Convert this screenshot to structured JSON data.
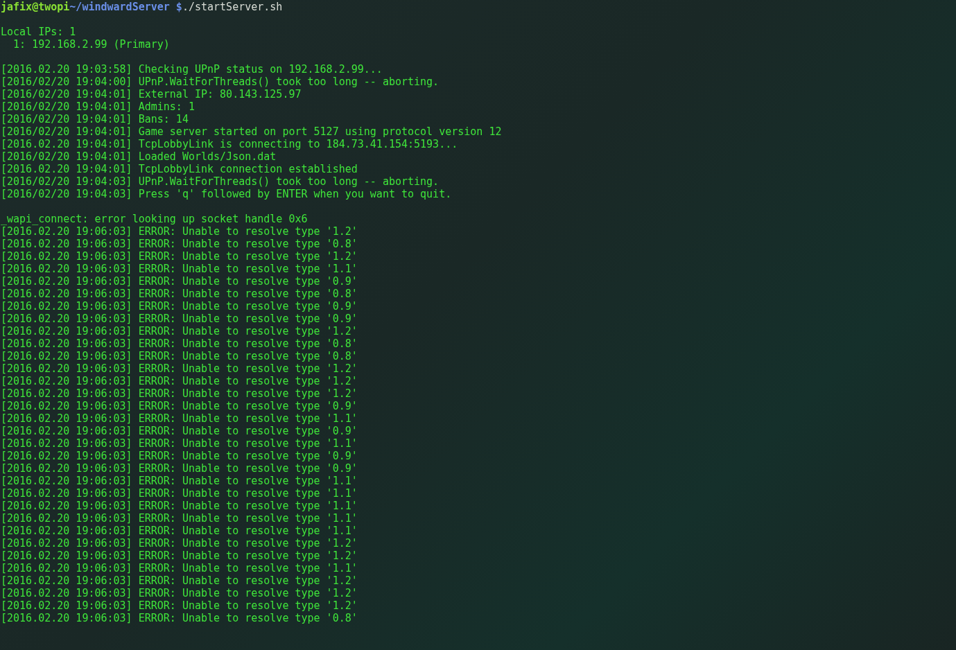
{
  "terminal": {
    "lines": [
      {
        "kind": "prompt",
        "user": "jafix@twopi",
        "path": "~/windwardServer $",
        "command": "./startServer.sh"
      },
      {
        "kind": "blank"
      },
      {
        "kind": "text",
        "text": "Local IPs: 1"
      },
      {
        "kind": "text",
        "text": "  1: 192.168.2.99 (Primary)"
      },
      {
        "kind": "blank"
      },
      {
        "kind": "text",
        "text": "[2016.02.20 19:03:58] Checking UPnP status on 192.168.2.99..."
      },
      {
        "kind": "text",
        "text": "[2016/02/20 19:04:00] UPnP.WaitForThreads() took too long -- aborting."
      },
      {
        "kind": "text",
        "text": "[2016/02/20 19:04:01] External IP: 80.143.125.97"
      },
      {
        "kind": "text",
        "text": "[2016/02/20 19:04:01] Admins: 1"
      },
      {
        "kind": "text",
        "text": "[2016/02/20 19:04:01] Bans: 14"
      },
      {
        "kind": "text",
        "text": "[2016/02/20 19:04:01] Game server started on port 5127 using protocol version 12"
      },
      {
        "kind": "text",
        "text": "[2016.02.20 19:04:01] TcpLobbyLink is connecting to 184.73.41.154:5193..."
      },
      {
        "kind": "text",
        "text": "[2016/02/20 19:04:01] Loaded Worlds/Json.dat"
      },
      {
        "kind": "text",
        "text": "[2016.02.20 19:04:01] TcpLobbyLink connection established"
      },
      {
        "kind": "text",
        "text": "[2016/02/20 19:04:03] UPnP.WaitForThreads() took too long -- aborting."
      },
      {
        "kind": "text",
        "text": "[2016/02/20 19:04:03] Press 'q' followed by ENTER when you want to quit."
      },
      {
        "kind": "blank"
      },
      {
        "kind": "text",
        "text": "_wapi_connect: error looking up socket handle 0x6"
      },
      {
        "kind": "text",
        "text": "[2016.02.20 19:06:03] ERROR: Unable to resolve type '1.2'"
      },
      {
        "kind": "text",
        "text": "[2016.02.20 19:06:03] ERROR: Unable to resolve type '0.8'"
      },
      {
        "kind": "text",
        "text": "[2016.02.20 19:06:03] ERROR: Unable to resolve type '1.2'"
      },
      {
        "kind": "text",
        "text": "[2016.02.20 19:06:03] ERROR: Unable to resolve type '1.1'"
      },
      {
        "kind": "text",
        "text": "[2016.02.20 19:06:03] ERROR: Unable to resolve type '0.9'"
      },
      {
        "kind": "text",
        "text": "[2016.02.20 19:06:03] ERROR: Unable to resolve type '0.8'"
      },
      {
        "kind": "text",
        "text": "[2016.02.20 19:06:03] ERROR: Unable to resolve type '0.9'"
      },
      {
        "kind": "text",
        "text": "[2016.02.20 19:06:03] ERROR: Unable to resolve type '0.9'"
      },
      {
        "kind": "text",
        "text": "[2016.02.20 19:06:03] ERROR: Unable to resolve type '1.2'"
      },
      {
        "kind": "text",
        "text": "[2016.02.20 19:06:03] ERROR: Unable to resolve type '0.8'"
      },
      {
        "kind": "text",
        "text": "[2016.02.20 19:06:03] ERROR: Unable to resolve type '0.8'"
      },
      {
        "kind": "text",
        "text": "[2016.02.20 19:06:03] ERROR: Unable to resolve type '1.2'"
      },
      {
        "kind": "text",
        "text": "[2016.02.20 19:06:03] ERROR: Unable to resolve type '1.2'"
      },
      {
        "kind": "text",
        "text": "[2016.02.20 19:06:03] ERROR: Unable to resolve type '1.2'"
      },
      {
        "kind": "text",
        "text": "[2016.02.20 19:06:03] ERROR: Unable to resolve type '0.9'"
      },
      {
        "kind": "text",
        "text": "[2016.02.20 19:06:03] ERROR: Unable to resolve type '1.1'"
      },
      {
        "kind": "text",
        "text": "[2016.02.20 19:06:03] ERROR: Unable to resolve type '0.9'"
      },
      {
        "kind": "text",
        "text": "[2016.02.20 19:06:03] ERROR: Unable to resolve type '1.1'"
      },
      {
        "kind": "text",
        "text": "[2016.02.20 19:06:03] ERROR: Unable to resolve type '0.9'"
      },
      {
        "kind": "text",
        "text": "[2016.02.20 19:06:03] ERROR: Unable to resolve type '0.9'"
      },
      {
        "kind": "text",
        "text": "[2016.02.20 19:06:03] ERROR: Unable to resolve type '1.1'"
      },
      {
        "kind": "text",
        "text": "[2016.02.20 19:06:03] ERROR: Unable to resolve type '1.1'"
      },
      {
        "kind": "text",
        "text": "[2016.02.20 19:06:03] ERROR: Unable to resolve type '1.1'"
      },
      {
        "kind": "text",
        "text": "[2016.02.20 19:06:03] ERROR: Unable to resolve type '1.1'"
      },
      {
        "kind": "text",
        "text": "[2016.02.20 19:06:03] ERROR: Unable to resolve type '1.1'"
      },
      {
        "kind": "text",
        "text": "[2016.02.20 19:06:03] ERROR: Unable to resolve type '1.2'"
      },
      {
        "kind": "text",
        "text": "[2016.02.20 19:06:03] ERROR: Unable to resolve type '1.2'"
      },
      {
        "kind": "text",
        "text": "[2016.02.20 19:06:03] ERROR: Unable to resolve type '1.1'"
      },
      {
        "kind": "text",
        "text": "[2016.02.20 19:06:03] ERROR: Unable to resolve type '1.2'"
      },
      {
        "kind": "text",
        "text": "[2016.02.20 19:06:03] ERROR: Unable to resolve type '1.2'"
      },
      {
        "kind": "text",
        "text": "[2016.02.20 19:06:03] ERROR: Unable to resolve type '1.2'"
      },
      {
        "kind": "text",
        "text": "[2016.02.20 19:06:03] ERROR: Unable to resolve type '0.8'"
      }
    ]
  }
}
